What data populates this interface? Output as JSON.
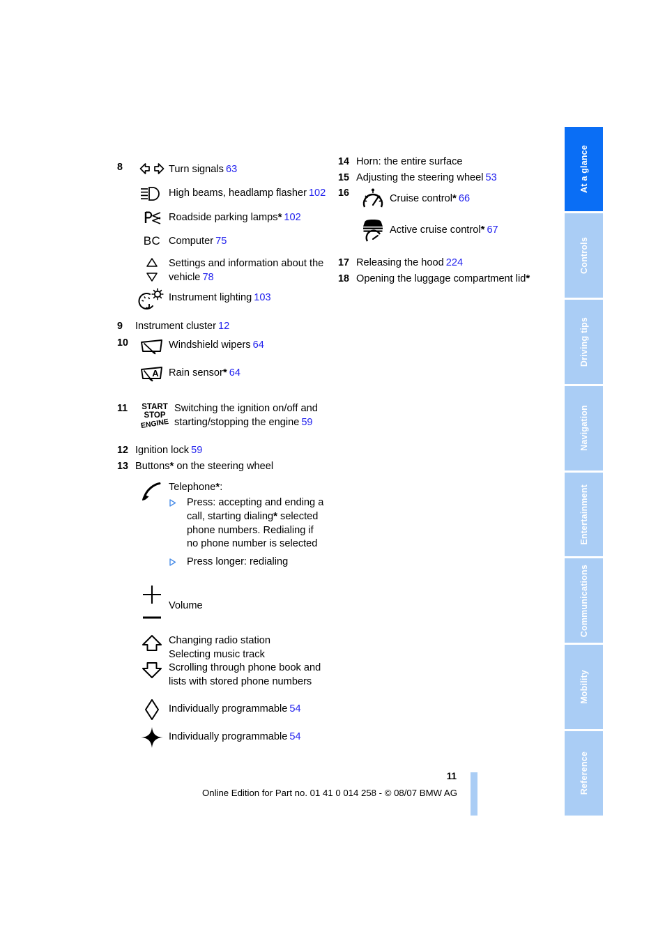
{
  "tabs": [
    {
      "label": "At a glance",
      "active": true
    },
    {
      "label": "Controls",
      "active": false
    },
    {
      "label": "Driving tips",
      "active": false
    },
    {
      "label": "Navigation",
      "active": false
    },
    {
      "label": "Entertainment",
      "active": false
    },
    {
      "label": "Communications",
      "active": false
    },
    {
      "label": "Mobility",
      "active": false
    },
    {
      "label": "Reference",
      "active": false
    }
  ],
  "colors": {
    "tab_active": "#0a6ef5",
    "tab_inactive": "#aacdf5",
    "page_reference": "#2222ee",
    "bullet": "#4d8fe8"
  },
  "left_column": {
    "item8": {
      "number": "8",
      "entries": [
        {
          "icon": "turn-signals-icon",
          "label": "Turn signals",
          "ref": "63"
        },
        {
          "icon": "high-beams-icon",
          "label": "High beams, headlamp flasher",
          "ref": "102"
        },
        {
          "icon": "roadside-parking-lamps-icon",
          "label": "Roadside parking lamps",
          "star": "*",
          "ref": "102"
        },
        {
          "icon": "bc-computer-icon",
          "label": "Computer",
          "ref": "75"
        },
        {
          "icon": "up-down-arrows-icon",
          "label": "Settings and information about the vehicle",
          "ref": "78"
        },
        {
          "icon": "instrument-lighting-icon",
          "label": "Instrument lighting",
          "ref": "103"
        }
      ]
    },
    "item9": {
      "number": "9",
      "label": "Instrument cluster",
      "ref": "12"
    },
    "item10": {
      "number": "10",
      "entries": [
        {
          "icon": "windshield-wipers-icon",
          "label": "Windshield wipers",
          "ref": "64"
        },
        {
          "icon": "rain-sensor-icon",
          "label": "Rain sensor",
          "star": "*",
          "ref": "64"
        }
      ]
    },
    "item11": {
      "number": "11",
      "icon": "start-stop-engine-icon",
      "icon_lines": {
        "line1": "START",
        "line2": "STOP",
        "line3": "ENGINE"
      },
      "label": "Switching the ignition on/off and starting/stopping the engine",
      "ref": "59"
    },
    "item12": {
      "number": "12",
      "label": "Ignition lock",
      "ref": "59"
    },
    "item13": {
      "number": "13",
      "label_before": "Buttons",
      "star": "*",
      "label_after": " on the steering wheel",
      "telephone": {
        "icon": "telephone-handset-icon",
        "heading_before": "Telephone",
        "star": "*",
        "heading_after": ":",
        "bullets": [
          {
            "text_a": "Press: accepting and ending a call, starting dialing",
            "star": "*",
            "text_b": " selected phone numbers. Redialing if no phone number is selected"
          },
          {
            "text_a": "Press longer: redialing",
            "star": "",
            "text_b": ""
          }
        ]
      },
      "volume": {
        "icon": "plus-minus-volume-icon",
        "label": "Volume"
      },
      "updown": {
        "icon": "up-down-block-arrows-icon",
        "lines": [
          "Changing radio station",
          "Selecting music track",
          "Scrolling through phone book and",
          "lists with stored phone numbers"
        ]
      },
      "programmable_1": {
        "icon": "diamond-outline-icon",
        "label": "Individually programmable",
        "ref": "54"
      },
      "programmable_2": {
        "icon": "star-diamond-icon",
        "label": "Individually programmable",
        "ref": "54"
      }
    }
  },
  "right_column": {
    "item14": {
      "number": "14",
      "label": "Horn: the entire surface"
    },
    "item15": {
      "number": "15",
      "label": "Adjusting the steering wheel",
      "ref": "53"
    },
    "item16": {
      "number": "16",
      "entries": [
        {
          "icon": "cruise-control-gauge-icon",
          "label": "Cruise control",
          "star": "*",
          "ref": "66"
        },
        {
          "icon": "active-cruise-control-icon",
          "label": "Active cruise control",
          "star": "*",
          "ref": "67"
        }
      ]
    },
    "item17": {
      "number": "17",
      "label": "Releasing the hood",
      "ref": "224"
    },
    "item18": {
      "number": "18",
      "label_before": "Opening the luggage compartment lid",
      "star": "*"
    }
  },
  "footer": {
    "page_number": "11",
    "text": "Online Edition for Part no. 01 41 0 014 258 - © 08/07 BMW AG"
  }
}
